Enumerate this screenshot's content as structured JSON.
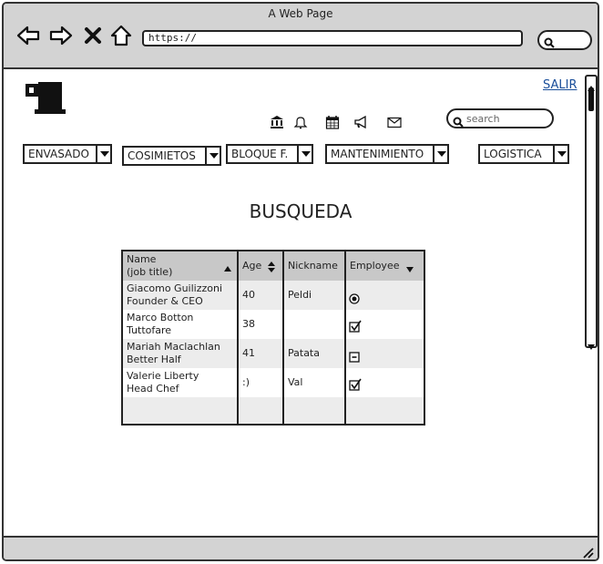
{
  "window": {
    "title": "A Web Page"
  },
  "browser": {
    "url": "https://"
  },
  "header": {
    "logout_label": "SALIR",
    "search_placeholder": "search"
  },
  "icons": [
    "bank-icon",
    "bell-icon",
    "calendar-icon",
    "megaphone-icon",
    "mail-icon"
  ],
  "menus": [
    {
      "label": "ENVASADO"
    },
    {
      "label": "COSIMIETOS"
    },
    {
      "label": "BLOQUE F."
    },
    {
      "label": "MANTENIMIENTO"
    },
    {
      "label": "LOGISTICA"
    }
  ],
  "main": {
    "title": "BUSQUEDA"
  },
  "table": {
    "columns": [
      "Name\n(job title)",
      "Age",
      "Nickname",
      "Employee"
    ],
    "rows": [
      {
        "name": "Giacomo Guilizzoni",
        "title": "Founder & CEO",
        "age": "40",
        "nickname": "Peldi",
        "employee": "radio-selected"
      },
      {
        "name": "Marco Botton",
        "title": "Tuttofare",
        "age": "38",
        "nickname": "",
        "employee": "checked"
      },
      {
        "name": "Mariah Maclachlan",
        "title": "Better Half",
        "age": "41",
        "nickname": "Patata",
        "employee": "indeterminate"
      },
      {
        "name": "Valerie Liberty",
        "title": "Head Chef",
        "age": ":)",
        "nickname": "Val",
        "employee": "checked"
      }
    ]
  }
}
